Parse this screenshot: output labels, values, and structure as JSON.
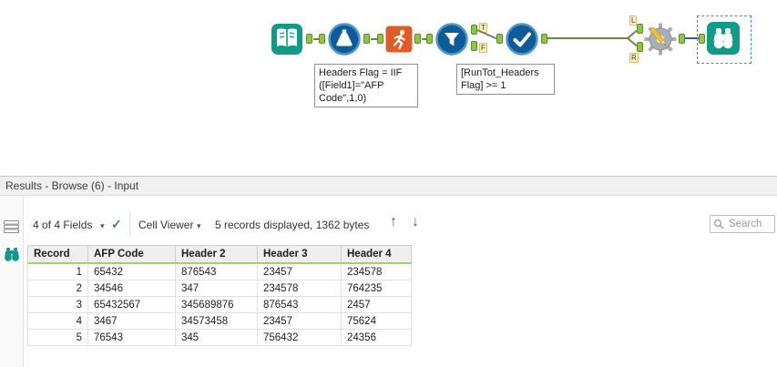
{
  "colors": {
    "teal": "#0f9b8a",
    "tool_blue": "#0d5c99",
    "tool_orange": "#df5b28",
    "anchor_green": "#8dc63f",
    "wire_olive": "#73814f",
    "wire_selected": "#4050c0",
    "selection_dash_blue": "#4a86d8",
    "header_underline_green": "#a6cf71"
  },
  "workflow": {
    "tool_icons": [
      "input-data",
      "formula",
      "running-total",
      "filter",
      "select",
      "macro-gear",
      "browse"
    ],
    "anchor_labels": {
      "t": "T",
      "f": "F",
      "l": "L",
      "r": "R"
    },
    "annotations": {
      "formula": "Headers Flag = IIF\n([Field1]=\"AFP\nCode\",1,0)",
      "filter": "[RunTot_Headers\nFlag] >= 1"
    }
  },
  "results": {
    "title": "Results - Browse (6) - Input",
    "toolbar": {
      "fields": "4 of 4 Fields",
      "cell_viewer": "Cell Viewer",
      "records": "5 records displayed, 1362 bytes",
      "search_placeholder": "Search"
    },
    "icons": {
      "caret": "▾",
      "check": "✓",
      "up": "↑",
      "down": "↓"
    },
    "table": {
      "columns": [
        "Record",
        "AFP Code",
        "Header 2",
        "Header 3",
        "Header 4"
      ],
      "rows": [
        [
          "1",
          "65432",
          "876543",
          "23457",
          "234578"
        ],
        [
          "2",
          "34546",
          "347",
          "234578",
          "764235"
        ],
        [
          "3",
          "65432567",
          "345689876",
          "876543",
          "2457"
        ],
        [
          "4",
          "3467",
          "34573458",
          "23457",
          "75624"
        ],
        [
          "5",
          "76543",
          "345",
          "756432",
          "24356"
        ]
      ]
    }
  }
}
